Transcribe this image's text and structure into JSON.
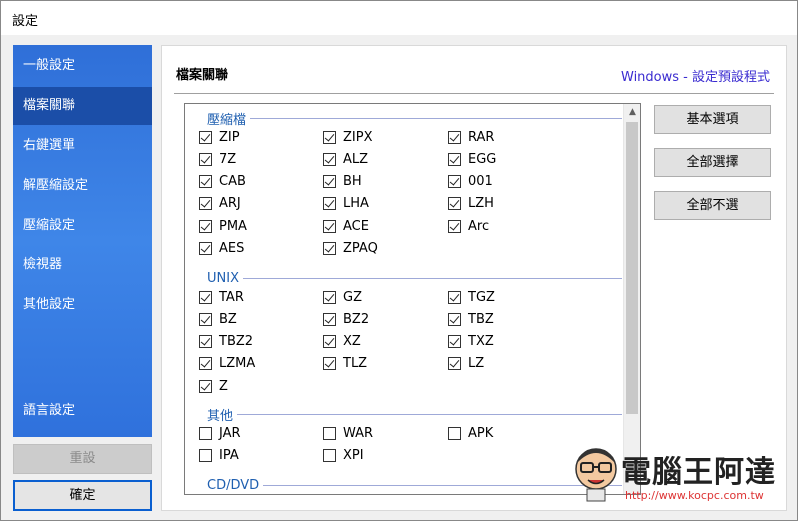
{
  "window": {
    "title": "設定"
  },
  "sidebar": {
    "items": [
      {
        "label": "一般設定",
        "active": false
      },
      {
        "label": "檔案關聯",
        "active": true
      },
      {
        "label": "右鍵選單",
        "active": false
      },
      {
        "label": "解壓縮設定",
        "active": false
      },
      {
        "label": "壓縮設定",
        "active": false
      },
      {
        "label": "檢視器",
        "active": false
      },
      {
        "label": "其他設定",
        "active": false
      }
    ],
    "language_label": "語言設定",
    "reset_label": "重設",
    "ok_label": "確定"
  },
  "panel": {
    "title": "檔案關聯",
    "link": "Windows - 設定預設程式"
  },
  "groups": [
    {
      "name": "壓縮檔",
      "items": [
        {
          "label": "ZIP",
          "checked": true
        },
        {
          "label": "ZIPX",
          "checked": true
        },
        {
          "label": "RAR",
          "checked": true
        },
        {
          "label": "7Z",
          "checked": true
        },
        {
          "label": "ALZ",
          "checked": true
        },
        {
          "label": "EGG",
          "checked": true
        },
        {
          "label": "CAB",
          "checked": true
        },
        {
          "label": "BH",
          "checked": true
        },
        {
          "label": "001",
          "checked": true
        },
        {
          "label": "ARJ",
          "checked": true
        },
        {
          "label": "LHA",
          "checked": true
        },
        {
          "label": "LZH",
          "checked": true
        },
        {
          "label": "PMA",
          "checked": true
        },
        {
          "label": "ACE",
          "checked": true
        },
        {
          "label": "Arc",
          "checked": true
        },
        {
          "label": "AES",
          "checked": true
        },
        {
          "label": "ZPAQ",
          "checked": true
        }
      ]
    },
    {
      "name": "UNIX",
      "items": [
        {
          "label": "TAR",
          "checked": true
        },
        {
          "label": "GZ",
          "checked": true
        },
        {
          "label": "TGZ",
          "checked": true
        },
        {
          "label": "BZ",
          "checked": true
        },
        {
          "label": "BZ2",
          "checked": true
        },
        {
          "label": "TBZ",
          "checked": true
        },
        {
          "label": "TBZ2",
          "checked": true
        },
        {
          "label": "XZ",
          "checked": true
        },
        {
          "label": "TXZ",
          "checked": true
        },
        {
          "label": "LZMA",
          "checked": true
        },
        {
          "label": "TLZ",
          "checked": true
        },
        {
          "label": "LZ",
          "checked": true
        },
        {
          "label": "Z",
          "checked": true
        }
      ]
    },
    {
      "name": "其他",
      "items": [
        {
          "label": "JAR",
          "checked": false
        },
        {
          "label": "WAR",
          "checked": false
        },
        {
          "label": "APK",
          "checked": false
        },
        {
          "label": "IPA",
          "checked": false
        },
        {
          "label": "XPI",
          "checked": false
        }
      ]
    },
    {
      "name": "CD/DVD",
      "items": []
    }
  ],
  "right_buttons": [
    "基本選項",
    "全部選擇",
    "全部不選"
  ],
  "watermark": {
    "text": "電腦王阿達",
    "url": "http://www.kocpc.com.tw"
  }
}
